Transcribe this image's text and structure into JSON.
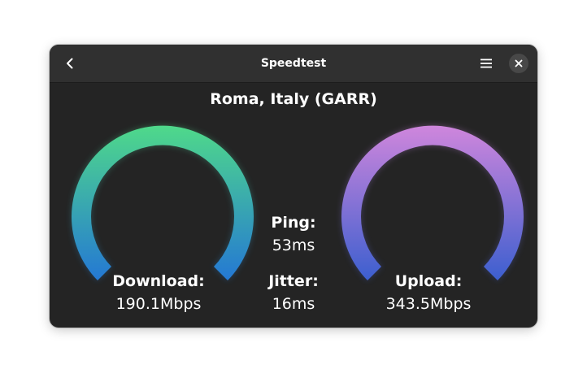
{
  "window": {
    "title": "Speedtest"
  },
  "server": "Roma, Italy (GARR)",
  "download": {
    "label": "Download:",
    "value": "190.1Mbps"
  },
  "upload": {
    "label": "Upload:",
    "value": "343.5Mbps"
  },
  "ping": {
    "label": "Ping:",
    "value": "53ms"
  },
  "jitter": {
    "label": "Jitter:",
    "value": "16ms"
  },
  "colors": {
    "download_gradient": [
      "#4fd98a",
      "#2478d4"
    ],
    "upload_gradient": [
      "#cf86dc",
      "#3c5fcf"
    ],
    "window_bg": "#242424",
    "titlebar_bg": "#303030"
  },
  "icons": {
    "back": "chevron-left-icon",
    "menu": "hamburger-menu-icon",
    "close": "close-icon"
  }
}
